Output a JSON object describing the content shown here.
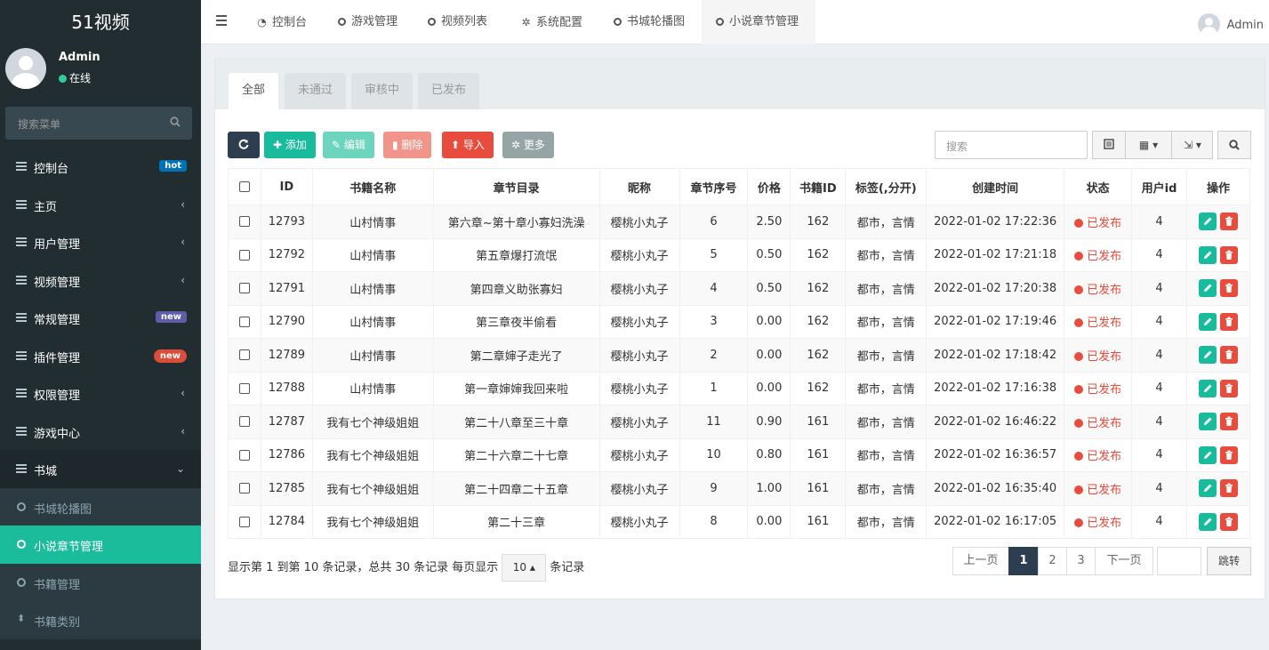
{
  "brand": "51视频",
  "user": {
    "name": "Admin",
    "status": "在线"
  },
  "sidebar_search": {
    "placeholder": "搜索菜单"
  },
  "menu": [
    {
      "label": "控制台",
      "icon": "dashboard-icon",
      "badge": "hot"
    },
    {
      "label": "主页",
      "icon": "list-icon",
      "chevron": "‹"
    },
    {
      "label": "用户管理",
      "icon": "list-icon",
      "chevron": "‹"
    },
    {
      "label": "视频管理",
      "icon": "list-icon",
      "chevron": "‹"
    },
    {
      "label": "常规管理",
      "icon": "cogs-icon",
      "badge": "new"
    },
    {
      "label": "插件管理",
      "icon": "rocket-icon",
      "badge": "new"
    },
    {
      "label": "权限管理",
      "icon": "group-icon",
      "chevron": "‹"
    },
    {
      "label": "游戏中心",
      "icon": "list-icon",
      "chevron": "‹"
    },
    {
      "label": "书城",
      "icon": "list-icon",
      "chevron": "⌄"
    }
  ],
  "submenu": [
    {
      "label": "书城轮播图"
    },
    {
      "label": "小说章节管理",
      "active": true
    },
    {
      "label": "书籍管理"
    },
    {
      "label": "书籍类别"
    }
  ],
  "topnav": {
    "tabs": [
      {
        "label": "控制台",
        "icon": "dashboard-icon"
      },
      {
        "label": "游戏管理",
        "icon": "circle-icon"
      },
      {
        "label": "视频列表",
        "icon": "circle-icon"
      },
      {
        "label": "系统配置",
        "icon": "gear-icon"
      },
      {
        "label": "书城轮播图",
        "icon": "circle-icon"
      },
      {
        "label": "小说章节管理",
        "icon": "circle-icon",
        "active": true
      }
    ],
    "user": "Admin"
  },
  "panel_tabs": [
    "全部",
    "未通过",
    "审核中",
    "已发布"
  ],
  "toolbar": {
    "add": "添加",
    "edit": "编辑",
    "delete": "删除",
    "import": "导入",
    "more": "更多",
    "search_placeholder": "搜索",
    "colors": {
      "refresh": "#2c3e50",
      "add": "#18bc9c",
      "edit": "#6dd5bd",
      "delete": "#f1948a",
      "import": "#e74c3c",
      "more": "#95a5a6"
    }
  },
  "table": {
    "columns": [
      "ID",
      "书籍名称",
      "章节目录",
      "昵称",
      "章节序号",
      "价格",
      "书籍ID",
      "标签(,分开)",
      "创建时间",
      "状态",
      "用户id",
      "操作"
    ],
    "rows": [
      {
        "id": "12793",
        "book": "山村情事",
        "chapter": "第六章~第十章小寡妇洗澡",
        "nick": "樱桃小丸子",
        "seq": "6",
        "price": "2.50",
        "book_id": "162",
        "tags": "都市，言情",
        "created": "2022-01-02 17:22:36",
        "status": "已发布",
        "uid": "4"
      },
      {
        "id": "12792",
        "book": "山村情事",
        "chapter": "第五章爆打流氓",
        "nick": "樱桃小丸子",
        "seq": "5",
        "price": "0.50",
        "book_id": "162",
        "tags": "都市，言情",
        "created": "2022-01-02 17:21:18",
        "status": "已发布",
        "uid": "4"
      },
      {
        "id": "12791",
        "book": "山村情事",
        "chapter": "第四章义助张寡妇",
        "nick": "樱桃小丸子",
        "seq": "4",
        "price": "0.50",
        "book_id": "162",
        "tags": "都市，言情",
        "created": "2022-01-02 17:20:38",
        "status": "已发布",
        "uid": "4"
      },
      {
        "id": "12790",
        "book": "山村情事",
        "chapter": "第三章夜半偷看",
        "nick": "樱桃小丸子",
        "seq": "3",
        "price": "0.00",
        "book_id": "162",
        "tags": "都市，言情",
        "created": "2022-01-02 17:19:46",
        "status": "已发布",
        "uid": "4"
      },
      {
        "id": "12789",
        "book": "山村情事",
        "chapter": "第二章婶子走光了",
        "nick": "樱桃小丸子",
        "seq": "2",
        "price": "0.00",
        "book_id": "162",
        "tags": "都市，言情",
        "created": "2022-01-02 17:18:42",
        "status": "已发布",
        "uid": "4"
      },
      {
        "id": "12788",
        "book": "山村情事",
        "chapter": "第一章婶婶我回来啦",
        "nick": "樱桃小丸子",
        "seq": "1",
        "price": "0.00",
        "book_id": "162",
        "tags": "都市，言情",
        "created": "2022-01-02 17:16:38",
        "status": "已发布",
        "uid": "4"
      },
      {
        "id": "12787",
        "book": "我有七个神级姐姐",
        "chapter": "第二十八章至三十章",
        "nick": "樱桃小丸子",
        "seq": "11",
        "price": "0.90",
        "book_id": "161",
        "tags": "都市，言情",
        "created": "2022-01-02 16:46:22",
        "status": "已发布",
        "uid": "4"
      },
      {
        "id": "12786",
        "book": "我有七个神级姐姐",
        "chapter": "第二十六章二十七章",
        "nick": "樱桃小丸子",
        "seq": "10",
        "price": "0.80",
        "book_id": "161",
        "tags": "都市，言情",
        "created": "2022-01-02 16:36:57",
        "status": "已发布",
        "uid": "4"
      },
      {
        "id": "12785",
        "book": "我有七个神级姐姐",
        "chapter": "第二十四章二十五章",
        "nick": "樱桃小丸子",
        "seq": "9",
        "price": "1.00",
        "book_id": "161",
        "tags": "都市，言情",
        "created": "2022-01-02 16:35:40",
        "status": "已发布",
        "uid": "4"
      },
      {
        "id": "12784",
        "book": "我有七个神级姐姐",
        "chapter": "第二十三章",
        "nick": "樱桃小丸子",
        "seq": "8",
        "price": "0.00",
        "book_id": "161",
        "tags": "都市，言情",
        "created": "2022-01-02 16:17:05",
        "status": "已发布",
        "uid": "4"
      }
    ]
  },
  "footer": {
    "info": "显示第 1 到第 10 条记录，总共 30 条记录 每页显示",
    "page_size": "10",
    "suffix": "条记录",
    "prev": "上一页",
    "pages": [
      "1",
      "2",
      "3"
    ],
    "current_page": "1",
    "next": "下一页",
    "jump": "跳转"
  }
}
